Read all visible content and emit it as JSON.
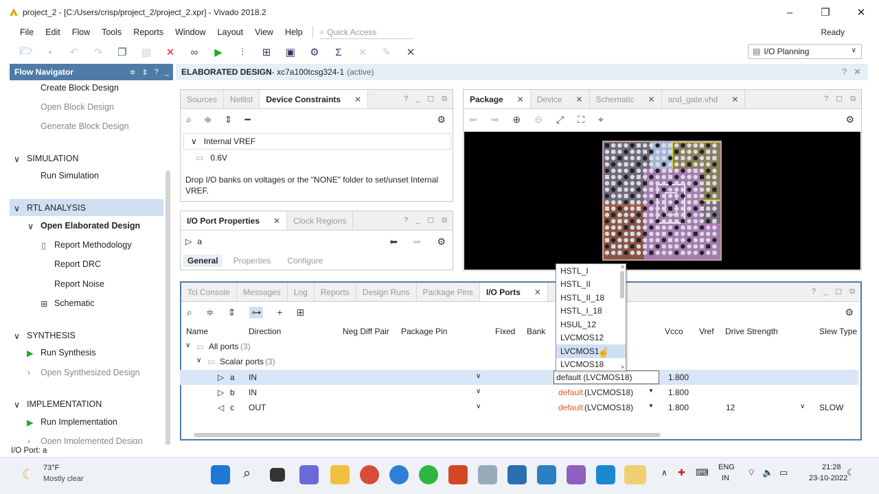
{
  "window": {
    "title": "project_2 - [C:/Users/crisp/project_2/project_2.xpr] - Vivado 2018.2",
    "status": "Ready"
  },
  "menu": [
    "File",
    "Edit",
    "Flow",
    "Tools",
    "Reports",
    "Window",
    "Layout",
    "View",
    "Help"
  ],
  "quick_access": "Quick Access",
  "layout_select": "I/O Planning",
  "flow_nav": {
    "title": "Flow Navigator",
    "items": [
      {
        "label": "Create Block Design",
        "dim": false
      },
      {
        "label": "Open Block Design",
        "dim": true
      },
      {
        "label": "Generate Block Design",
        "dim": true
      },
      {
        "label": "SIMULATION",
        "section": true
      },
      {
        "label": "Run Simulation"
      },
      {
        "label": "RTL ANALYSIS",
        "section": true
      },
      {
        "label": "Open Elaborated Design"
      },
      {
        "label": "Report Methodology"
      },
      {
        "label": "Report DRC"
      },
      {
        "label": "Report Noise"
      },
      {
        "label": "Schematic"
      },
      {
        "label": "SYNTHESIS",
        "section": true
      },
      {
        "label": "Run Synthesis"
      },
      {
        "label": "Open Synthesized Design",
        "dim": true
      },
      {
        "label": "IMPLEMENTATION",
        "section": true
      },
      {
        "label": "Run Implementation"
      },
      {
        "label": "Open Implemented Design",
        "dim": true
      }
    ]
  },
  "editor": {
    "title": "ELABORATED DESIGN",
    "part": " - xc7a100tcsg324-1",
    "state": "(active)"
  },
  "constraints_panel": {
    "tabs": [
      "Sources",
      "Netlist",
      "Device Constraints"
    ],
    "tree_item": "Internal VREF",
    "value": "0.6V",
    "hint": "Drop I/O banks on voltages or the \"NONE\" folder to set/unset Internal VREF."
  },
  "port_props": {
    "tabs": [
      "I/O Port Properties",
      "Clock Regions"
    ],
    "port": "a",
    "subtabs": [
      "General",
      "Properties",
      "Configure"
    ]
  },
  "package_panel": {
    "tabs": [
      "Package",
      "Device",
      "Schematic",
      "and_gate.vhd"
    ]
  },
  "io_panel": {
    "tabs": [
      "Tcl Console",
      "Messages",
      "Log",
      "Reports",
      "Design Runs",
      "Package Pins",
      "I/O Ports"
    ],
    "columns": [
      "Name",
      "Direction",
      "Neg Diff Pair",
      "Package Pin",
      "Fixed",
      "Bank",
      "Vcco",
      "Vref",
      "Drive Strength",
      "Slew Type"
    ],
    "all_ports": "All ports",
    "all_count": "(3)",
    "scalar_ports": "Scalar ports",
    "scalar_count": "(3)",
    "rows": [
      {
        "name": "a",
        "dir": "IN",
        "std": "default (LVCMOS18)",
        "vcco": "1.800",
        "drive": "",
        "slew": ""
      },
      {
        "name": "b",
        "dir": "IN",
        "std_default": "default",
        "std_val": "(LVCMOS18)",
        "vcco": "1.800",
        "drive": "",
        "slew": ""
      },
      {
        "name": "c",
        "dir": "OUT",
        "std_default": "default",
        "std_val": "(LVCMOS18)",
        "vcco": "1.800",
        "drive": "12",
        "slew": "SLOW"
      }
    ]
  },
  "dropdown": {
    "options": [
      "HSTL_I",
      "HSTL_II",
      "HSTL_II_18",
      "HSTL_I_18",
      "HSUL_12",
      "LVCMOS12",
      "LVCMOS15",
      "LVCMOS18"
    ],
    "shown": [
      "HSTL_I",
      "HSTL_II",
      "HSTL_II_18",
      "HSTL_I_18",
      "HSUL_12",
      "LVCMOS12",
      "LVCMOS1",
      "LVCMOS18"
    ],
    "selected_index": 6
  },
  "statusbar": "I/O Port: a",
  "taskbar": {
    "weather_temp": "73°F",
    "weather_desc": "Mostly clear",
    "lang1": "ENG",
    "lang2": "IN",
    "time": "21:28",
    "date": "23-10-2022"
  }
}
